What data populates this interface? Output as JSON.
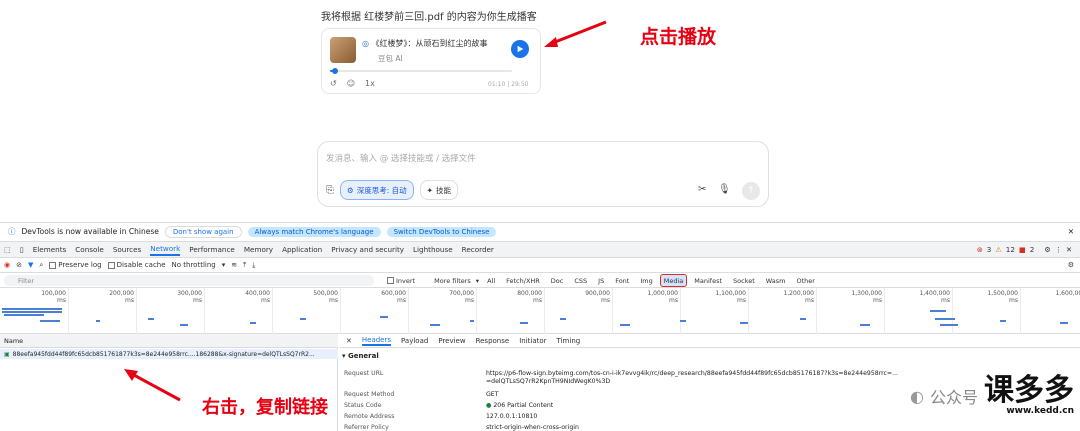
{
  "chat": {
    "message": "我将根据 红楼梦前三回.pdf 的内容为你生成播客",
    "podcast": {
      "title": "《红楼梦》：从顽石到红尘的故事",
      "source": "豆包 AI",
      "progress_fraction": 0.03,
      "current_time": "01:10",
      "total_time": "29:50",
      "speed": "1x"
    },
    "input_placeholder": "发消息、输入 @ 选择技能或 / 选择文件",
    "tools": {
      "deep_think": "深度思考: 自动",
      "skills": "技能"
    },
    "accent_color": "#1a73e8"
  },
  "annotations": {
    "play_hint": "点击播放",
    "copy_hint": "右击，复制链接"
  },
  "devtools": {
    "banner": {
      "text": "DevTools is now available in Chinese",
      "dont_show": "Don't show again",
      "always_match": "Always match Chrome's language",
      "switch": "Switch DevTools to Chinese"
    },
    "tabs": [
      "Elements",
      "Console",
      "Sources",
      "Network",
      "Performance",
      "Memory",
      "Application",
      "Privacy and security",
      "Lighthouse",
      "Recorder"
    ],
    "active_tab": "Network",
    "badges": {
      "errors": "3",
      "warnings": "12",
      "issues": "2"
    },
    "toolbar": {
      "preserve_log": "Preserve log",
      "disable_cache": "Disable cache",
      "throttling": "No throttling"
    },
    "filter": {
      "placeholder": "Filter",
      "invert": "Invert",
      "more_filters": "More filters",
      "types": [
        "All",
        "Fetch/XHR",
        "Doc",
        "CSS",
        "JS",
        "Font",
        "Img",
        "Media",
        "Manifest",
        "Socket",
        "Wasm",
        "Other"
      ],
      "active_type": "Media"
    },
    "timeline_ticks": [
      "100,000 ms",
      "200,000 ms",
      "300,000 ms",
      "400,000 ms",
      "500,000 ms",
      "600,000 ms",
      "700,000 ms",
      "800,000 ms",
      "900,000 ms",
      "1,000,000 ms",
      "1,100,000 ms",
      "1,200,000 ms",
      "1,300,000 ms",
      "1,400,000 ms",
      "1,500,000 ms",
      "1,600,000"
    ],
    "name_header": "Name",
    "request_name": "88eefa945fdd44f89fc65dcb851761877k3s=8e244e958rrc....186288&x-signature=delQTLsSQ7rR2...",
    "detail_tabs": [
      "Headers",
      "Payload",
      "Preview",
      "Response",
      "Initiator",
      "Timing"
    ],
    "active_detail_tab": "Headers",
    "general": {
      "title": "General",
      "rows": [
        {
          "key": "Request URL",
          "value": "https://p6-flow-sign.byteimg.com/tos-cn-i-ik7evvg4ik/rc/deep_research/88eefa945fdd44f89fc65dcb85176187?k3s=8e244e958rrc=..."
        },
        {
          "key": "",
          "value": "=delQTLsSQ7rR2KpnTH9NIdWegK0%3D"
        },
        {
          "key": "Request Method",
          "value": "GET"
        },
        {
          "key": "Status Code",
          "value": "206 Partial Content"
        },
        {
          "key": "Remote Address",
          "value": "127.0.0.1:10810"
        },
        {
          "key": "Referrer Policy",
          "value": "strict-origin-when-cross-origin"
        }
      ]
    }
  },
  "watermark": {
    "wechat_label": "公众号",
    "brand": "课多多",
    "site": "www.kedd.cn"
  }
}
